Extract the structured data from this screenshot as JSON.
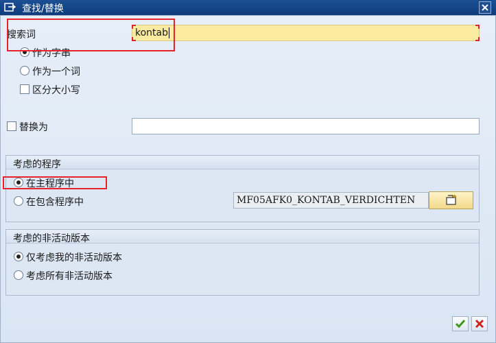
{
  "window": {
    "title": "查找/替换"
  },
  "search": {
    "label": "搜索词",
    "value": "kontab",
    "options": [
      {
        "label": "作为字串",
        "selected": true
      },
      {
        "label": "作为一个词",
        "selected": false
      }
    ],
    "case_sensitive": {
      "label": "区分大小写",
      "checked": false
    }
  },
  "replace": {
    "label": "替换为",
    "checked": false,
    "value": ""
  },
  "programs": {
    "title": "考虑的程序",
    "main_program": {
      "label": "在主程序中",
      "selected": true
    },
    "include_program": {
      "label": "在包含程序中",
      "selected": false,
      "value": "MF05AFK0_KONTAB_VERDICHTEN"
    }
  },
  "inactive": {
    "title": "考虑的非活动版本",
    "only_mine": {
      "label": "仅考虑我的非活动版本",
      "selected": true
    },
    "all": {
      "label": "考虑所有非活动版本",
      "selected": false
    }
  },
  "colors": {
    "highlight": "#e8222a",
    "required_field": "#fbeba0"
  },
  "icons": {
    "title": "find-replace-icon",
    "close": "close-icon",
    "open": "open-folder-icon",
    "ok": "checkmark-icon",
    "cancel": "cancel-icon"
  }
}
